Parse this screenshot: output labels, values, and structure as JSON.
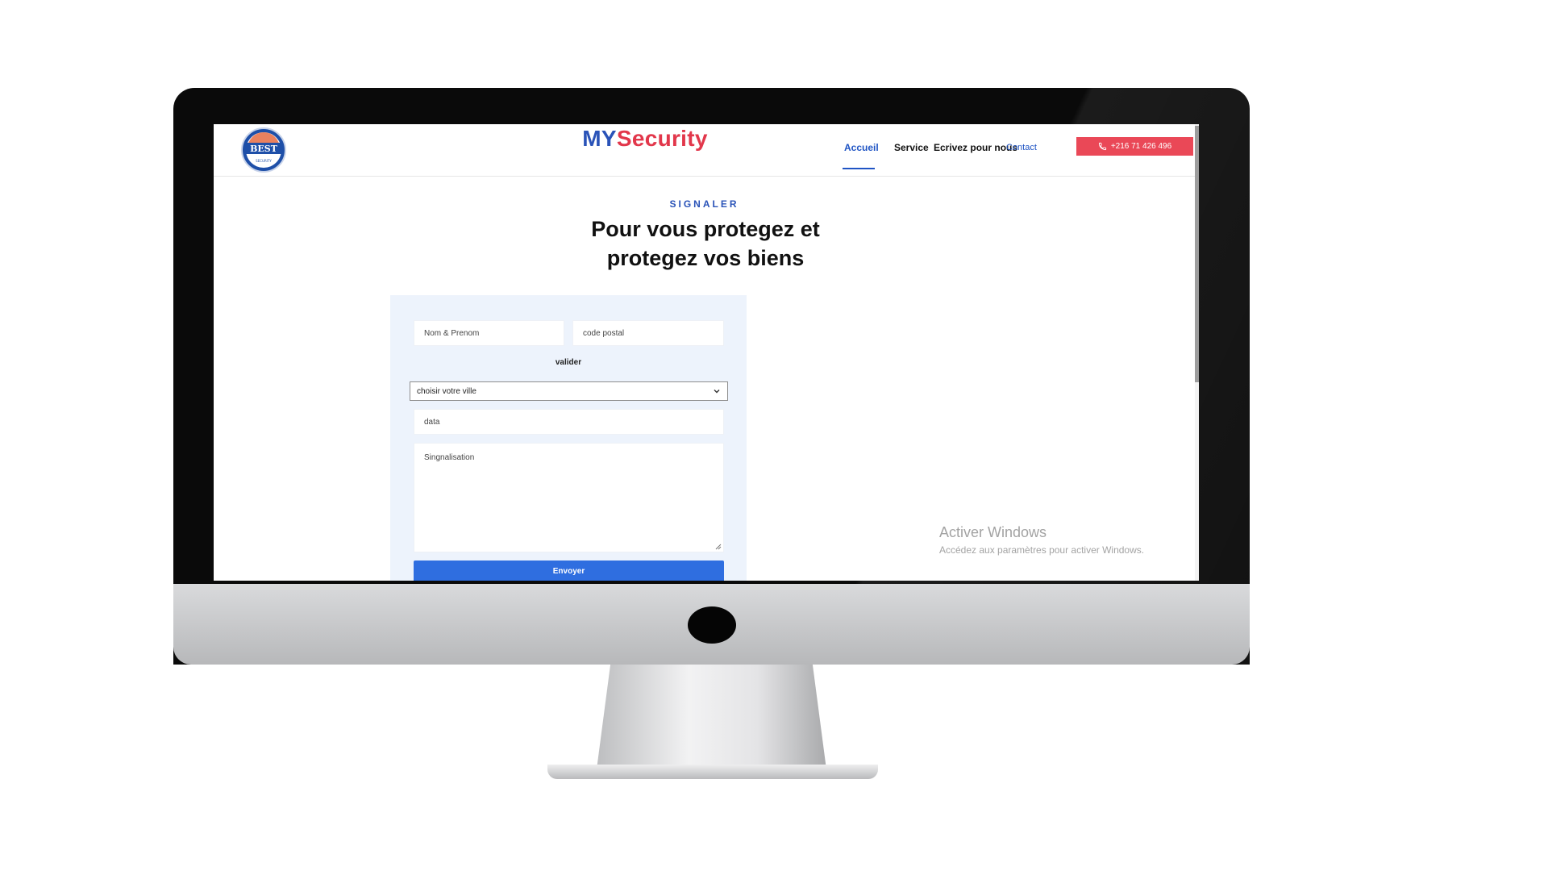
{
  "brand": {
    "my": "MY",
    "security": "Security",
    "logo_text": "BEST",
    "logo_subtext": "SECURITY"
  },
  "nav": {
    "items": [
      {
        "label": "Accueil",
        "active": true
      },
      {
        "label": "Service"
      },
      {
        "label": "Ecrivez pour nous"
      },
      {
        "label": "Contact"
      }
    ],
    "phone_label": "+216 71 426 496"
  },
  "section": {
    "eyebrow": "SIGNALER",
    "headline_line1": "Pour vous protegez et",
    "headline_line2": "protegez vos biens"
  },
  "form": {
    "name_placeholder": "Nom & Prenom",
    "postal_placeholder": "code postal",
    "validate_label": "valider",
    "city_select_value": "choisir votre ville",
    "data_placeholder": "data",
    "report_placeholder": "Singnalisation",
    "submit_label": "Envoyer"
  },
  "watermark": {
    "title": "Activer Windows",
    "subtitle": "Accédez aux paramètres pour activer Windows."
  },
  "colors": {
    "primary": "#2a53b8",
    "accent_red": "#e2374b",
    "phone_button": "#ea4857",
    "submit_button": "#2f6ee0",
    "form_background": "#edf3fc"
  }
}
